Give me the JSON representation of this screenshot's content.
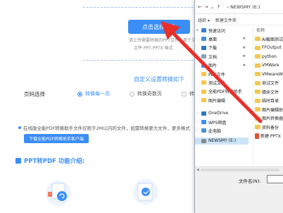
{
  "web": {
    "upload_button": "点击选择文件",
    "upload_hint_line1": "请上传需要转换的PPT文件，单个文件最大支持2M",
    "upload_hint_line2": "文件 PPT,PPTX 格式",
    "custom_settings": "自定义设置转换如下",
    "page_select_label": "页码选择",
    "radio_options": [
      "转换每一页",
      "转换奇数页",
      "转"
    ],
    "notice": "在线版全能PDF转换助手文件仅限于2M以内的文件，如需转换更大文件，更多格式",
    "client_button": "下载全能PDF转换助手客户端",
    "feature_title": "PPT转PDF 功能介绍:"
  },
  "dialog": {
    "breadcrumb": "NEWSMY (E:)",
    "toolbar": [
      "组织 ▾",
      "新建文件夹"
    ],
    "nav_items": [
      {
        "label": "快速访问",
        "icon": "star-icon",
        "color": "#3a7bd5",
        "chev": "▾"
      },
      {
        "label": "桌面",
        "icon": "desktop-icon",
        "color": "#4a90d9",
        "pin": "✱"
      },
      {
        "label": "下载",
        "icon": "download-icon",
        "color": "#2b78c2",
        "pin": "✱"
      },
      {
        "label": "文档",
        "icon": "document-icon",
        "color": "#8aa0b8",
        "pin": "✱"
      },
      {
        "label": "图片",
        "icon": "picture-icon",
        "color": "#4a90d9",
        "pin": "✱"
      },
      {
        "label": "PDF文件",
        "icon": "folder-icon",
        "color": "#f5c74a"
      },
      {
        "label": "测试文件",
        "icon": "folder-icon",
        "color": "#f5c74a"
      },
      {
        "label": "全能PDF转换助手",
        "icon": "folder-icon",
        "color": "#f5c74a"
      },
      {
        "label": "图片编辑",
        "icon": "folder-icon",
        "color": "#f5c74a"
      },
      {
        "label": "OneDrive",
        "icon": "cloud-icon",
        "color": "#2b78c2",
        "chev": "›"
      },
      {
        "label": "WPS网盘",
        "icon": "cloud-icon",
        "color": "#3a8ef6",
        "chev": "›"
      },
      {
        "label": "此电脑",
        "icon": "computer-icon",
        "color": "#4a90d9",
        "chev": "›"
      },
      {
        "label": "NEWSMY (E:)",
        "icon": "drive-icon",
        "color": "#8a8a8a",
        "chev": "›",
        "selected": true
      }
    ],
    "column_header": "名称",
    "files": [
      {
        "label": "AI截图测试",
        "type": "folder"
      },
      {
        "label": "FFOutput",
        "type": "folder"
      },
      {
        "label": "python",
        "type": "folder"
      },
      {
        "label": "VMWare",
        "type": "folder"
      },
      {
        "label": "VMwareWin",
        "type": "folder"
      },
      {
        "label": "测试文件",
        "type": "folder"
      },
      {
        "label": "猜命文件",
        "type": "folder"
      },
      {
        "label": "临时目录",
        "type": "folder"
      },
      {
        "label": "图片编辑助手",
        "type": "folder"
      },
      {
        "label": "图片转换器",
        "type": "folder"
      },
      {
        "label": "资料备份",
        "type": "folder"
      },
      {
        "label": "新建 PPTX",
        "type": "pptx"
      }
    ],
    "filename_label": "文件名(N):",
    "filename_value": ""
  },
  "colors": {
    "accent": "#3a8ef6",
    "arrow": "#e8302a"
  }
}
